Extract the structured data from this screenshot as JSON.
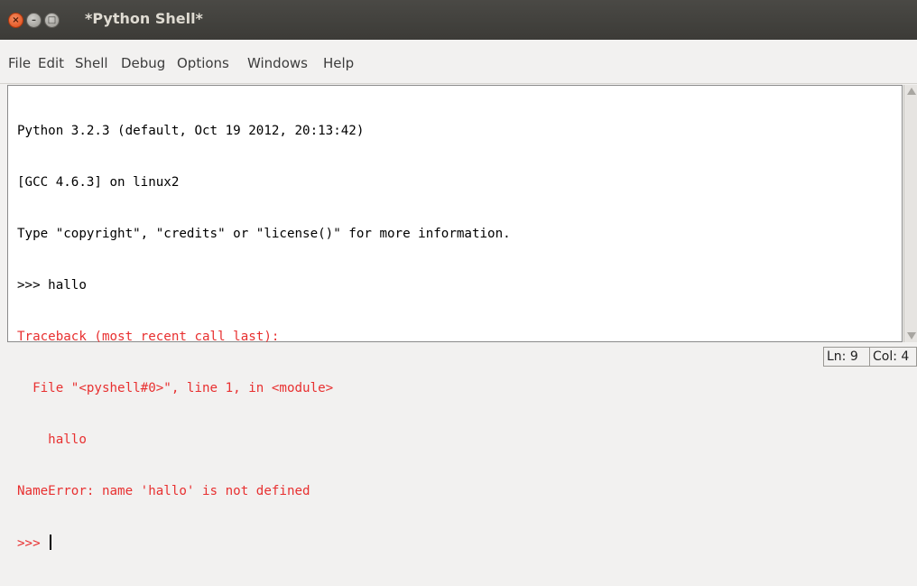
{
  "window": {
    "title": "*Python Shell*",
    "controls": {
      "close_glyph": "×",
      "minimize_glyph": "–",
      "maximize_glyph": "□"
    }
  },
  "menu": {
    "items": [
      {
        "label": "File"
      },
      {
        "label": "Edit"
      },
      {
        "label": "Shell"
      },
      {
        "label": "Debug"
      },
      {
        "label": "Options"
      },
      {
        "label": "Windows"
      },
      {
        "label": "Help"
      }
    ]
  },
  "shell": {
    "lines": [
      {
        "text": "Python 3.2.3 (default, Oct 19 2012, 20:13:42)",
        "color": "#000000"
      },
      {
        "text": "[GCC 4.6.3] on linux2",
        "color": "#000000"
      },
      {
        "text": "Type \"copyright\", \"credits\" or \"license()\" for more information.",
        "color": "#000000"
      },
      {
        "text": ">>> hallo",
        "color": "#000000"
      },
      {
        "text": "Traceback (most recent call last):",
        "color": "#e83030"
      },
      {
        "text": "  File \"<pyshell#0>\", line 1, in <module>",
        "color": "#e83030"
      },
      {
        "text": "    hallo",
        "color": "#e83030"
      },
      {
        "text": "NameError: name 'hallo' is not defined",
        "color": "#e83030"
      },
      {
        "text": ">>> ",
        "color": "#e83030"
      }
    ]
  },
  "status": {
    "line": "Ln: 9",
    "col": "Col: 4"
  }
}
